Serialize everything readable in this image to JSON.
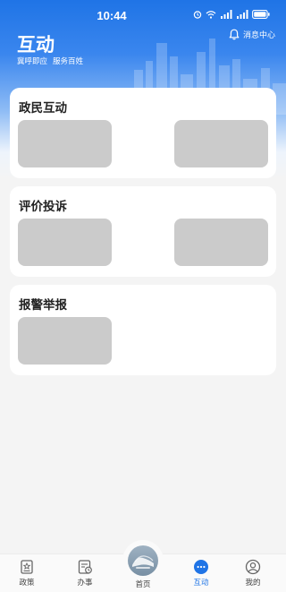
{
  "status_bar": {
    "time": "10:44"
  },
  "header": {
    "title": "互动",
    "subtitle_parts": [
      "冀呼即应",
      "服务百姓"
    ],
    "message_center_label": "消息中心"
  },
  "sections": [
    {
      "title": "政民互动"
    },
    {
      "title": "评价投诉"
    },
    {
      "title": "报警举报"
    }
  ],
  "tabbar": {
    "items": [
      {
        "label": "政策",
        "icon": "policy-icon"
      },
      {
        "label": "办事",
        "icon": "service-icon"
      },
      {
        "label": "首页",
        "icon": "home-icon"
      },
      {
        "label": "互动",
        "icon": "chat-bubble-icon"
      },
      {
        "label": "我的",
        "icon": "user-icon"
      }
    ],
    "active_index": 3,
    "active_color": "#1f74e6"
  },
  "colors": {
    "header_blue": "#1f74e6",
    "background": "#f4f4f4",
    "placeholder": "#cbcbcb"
  }
}
